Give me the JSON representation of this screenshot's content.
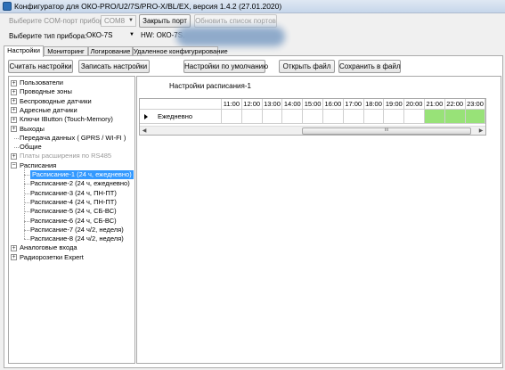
{
  "window": {
    "title": "Конфигуратор для ОКО-PRO/U2/7S/PRO-X/BL/EX, версия 1.4.2 (27.01.2020)"
  },
  "toolbar": {
    "com_port_label": "Выберите COM-порт прибора",
    "com_port_value": "COM8",
    "close_port_label": "Закрыть порт",
    "refresh_ports_label": "Обновить список портов",
    "device_type_label": "Выберите тип прибора:",
    "device_type_value": "ОКО-7S",
    "hw_label": "HW: ОКО-7S,"
  },
  "tabs": [
    {
      "label": "Настройки",
      "active": true
    },
    {
      "label": "Мониторинг",
      "active": false
    },
    {
      "label": "Логирование",
      "active": false
    },
    {
      "label": "Удаленное конфигурирование",
      "active": false
    }
  ],
  "actions": {
    "read_settings": "Считать настройки",
    "write_settings": "Записать настройки",
    "default_settings": "Настройки по умолчанию",
    "open_file": "Открыть файл",
    "save_to_file": "Сохранить в файл"
  },
  "tree": {
    "nodes": [
      {
        "label": "Пользователи",
        "expander": "+"
      },
      {
        "label": "Проводные зоны",
        "expander": "+"
      },
      {
        "label": "Беспроводные датчики",
        "expander": "+"
      },
      {
        "label": "Адресные датчики",
        "expander": "+"
      },
      {
        "label": "Ключи IButton (Touch-Memory)",
        "expander": "+"
      },
      {
        "label": "Выходы",
        "expander": "+"
      },
      {
        "label": "Передача данных ( GPRS / WI-FI )",
        "expander": ""
      },
      {
        "label": "Общие",
        "expander": ""
      },
      {
        "label": "Платы расширения по RS485",
        "expander": "+",
        "disabled": true
      },
      {
        "label": "Расписания",
        "expander": "−"
      },
      {
        "label": "Расписание-1 (24 ч, ежедневно)",
        "child": true,
        "selected": true
      },
      {
        "label": "Расписание-2 (24 ч, ежедневно)",
        "child": true
      },
      {
        "label": "Расписание-3 (24 ч, ПН-ПТ)",
        "child": true
      },
      {
        "label": "Расписание-4 (24 ч, ПН-ПТ)",
        "child": true
      },
      {
        "label": "Расписание-5 (24 ч, СБ-ВС)",
        "child": true
      },
      {
        "label": "Расписание-6 (24 ч, СБ-ВС)",
        "child": true
      },
      {
        "label": "Расписание-7 (24 ч/2, неделя)",
        "child": true
      },
      {
        "label": "Расписание-8 (24 ч/2, неделя)",
        "child": true
      },
      {
        "label": "Аналоговые входа",
        "expander": "+"
      },
      {
        "label": "Радиорозетки Expert",
        "expander": "+"
      }
    ]
  },
  "schedule": {
    "title": "Настройки расписания-1",
    "hours": [
      "11:00",
      "12:00",
      "13:00",
      "14:00",
      "15:00",
      "16:00",
      "17:00",
      "18:00",
      "19:00",
      "20:00",
      "21:00",
      "22:00",
      "23:00"
    ],
    "row_label": "Ежедневно",
    "active_hours": [
      "21:00",
      "22:00",
      "23:00"
    ],
    "active_color": "#98e278",
    "selected_color": "#3399ff"
  }
}
